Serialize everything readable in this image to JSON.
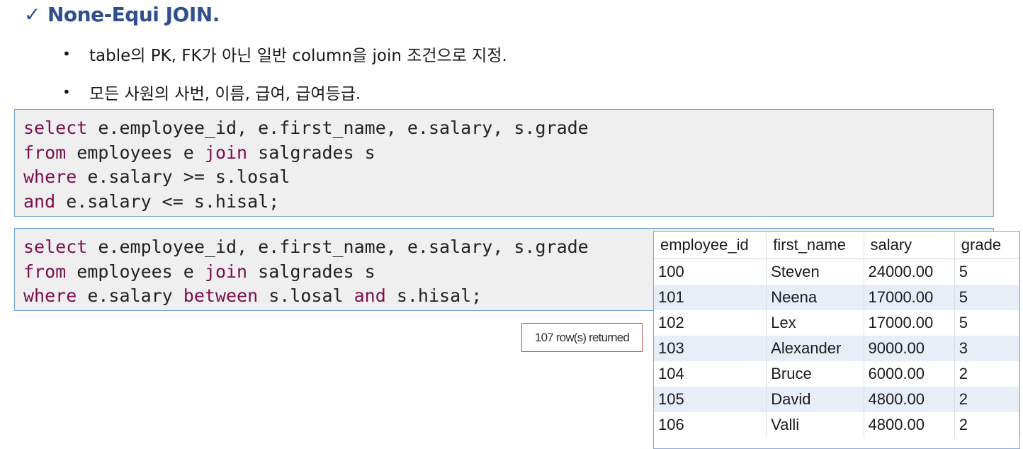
{
  "heading": {
    "check": "✓",
    "title": "None-Equi JOIN."
  },
  "bullets": [
    "table의 PK, FK가 아닌 일반 column을 join 조건으로 지정.",
    "모든 사원의 사번, 이름, 급여, 급여등급."
  ],
  "code1": [
    [
      {
        "t": "select",
        "k": true
      },
      {
        "t": " e.employee_id, e.first_name, e.salary, s.grade",
        "k": false
      }
    ],
    [
      {
        "t": "from",
        "k": true
      },
      {
        "t": " employees e ",
        "k": false
      },
      {
        "t": "join",
        "k": true
      },
      {
        "t": " salgrades s",
        "k": false
      }
    ],
    [
      {
        "t": "where",
        "k": true
      },
      {
        "t": " e.salary >= s.losal",
        "k": false
      }
    ],
    [
      {
        "t": "and",
        "k": true
      },
      {
        "t": " e.salary <= s.hisal;",
        "k": false
      }
    ]
  ],
  "code2": [
    [
      {
        "t": "select",
        "k": true
      },
      {
        "t": " e.employee_id, e.first_name, e.salary, s.grade",
        "k": false
      }
    ],
    [
      {
        "t": "from",
        "k": true
      },
      {
        "t": " employees e ",
        "k": false
      },
      {
        "t": "join",
        "k": true
      },
      {
        "t": " salgrades s",
        "k": false
      }
    ],
    [
      {
        "t": "where",
        "k": true
      },
      {
        "t": " e.salary ",
        "k": false
      },
      {
        "t": "between",
        "k": true
      },
      {
        "t": " s.losal ",
        "k": false
      },
      {
        "t": "and",
        "k": true
      },
      {
        "t": " s.hisal;",
        "k": false
      }
    ]
  ],
  "result_status": "107 row(s) returned",
  "results": {
    "columns": [
      "employee_id",
      "first_name",
      "salary",
      "grade"
    ],
    "rows": [
      [
        "100",
        "Steven",
        "24000.00",
        "5"
      ],
      [
        "101",
        "Neena",
        "17000.00",
        "5"
      ],
      [
        "102",
        "Lex",
        "17000.00",
        "5"
      ],
      [
        "103",
        "Alexander",
        "9000.00",
        "3"
      ],
      [
        "104",
        "Bruce",
        "6000.00",
        "2"
      ],
      [
        "105",
        "David",
        "4800.00",
        "2"
      ],
      [
        "106",
        "Valli",
        "4800.00",
        "2"
      ]
    ]
  },
  "colors": {
    "keyword": "#7a0f4d",
    "heading": "#2f4f8f",
    "code_border": "#6fa3d6",
    "status_border": "#c0504d"
  }
}
